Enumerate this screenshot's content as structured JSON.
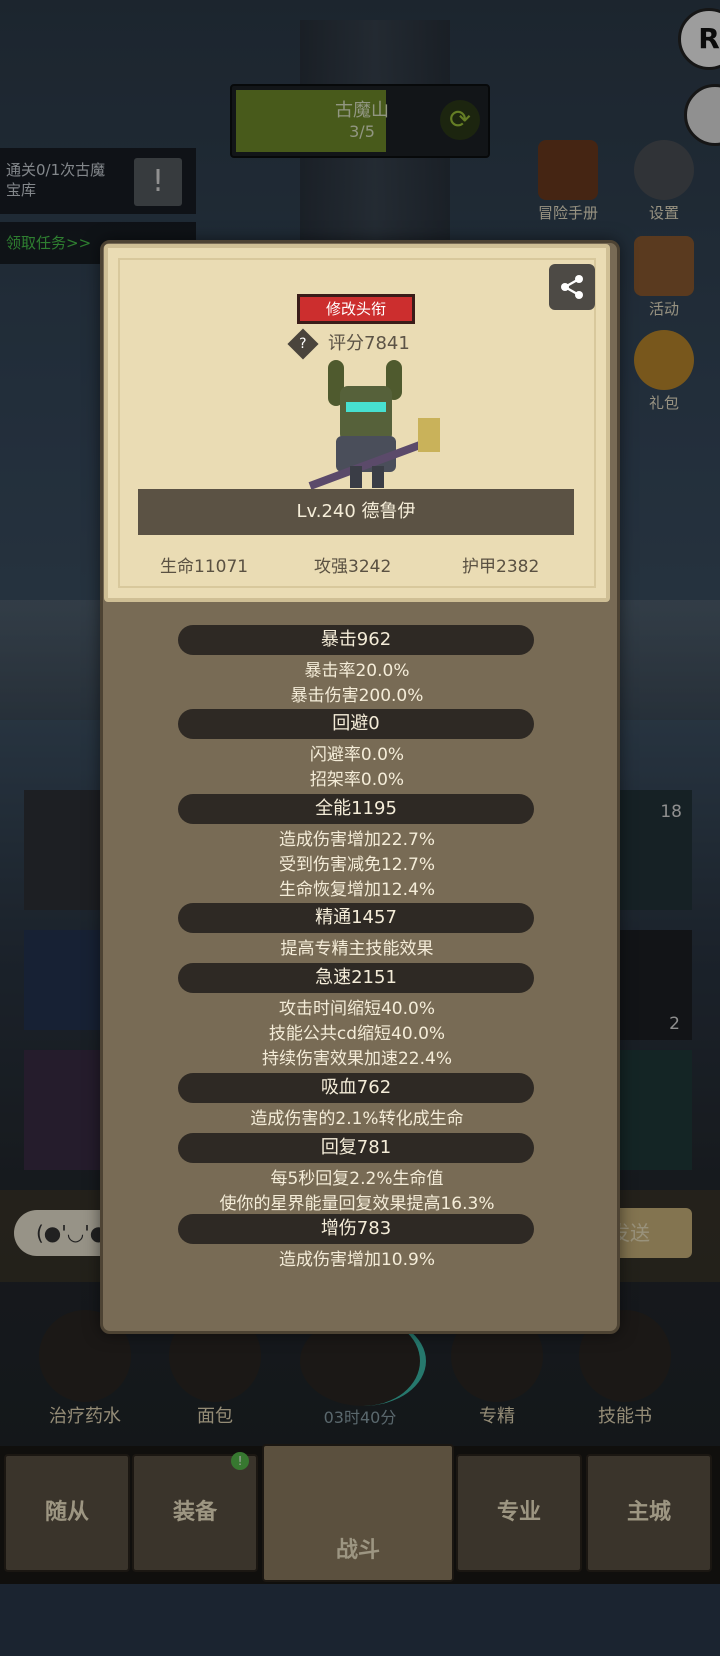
{
  "stage": {
    "name": "古魔山",
    "progress": "3/5"
  },
  "quest": {
    "text": "通关0/1次古魔宝库",
    "claim_label": "领取任务>>"
  },
  "right_menu": {
    "handbook": "冒险手册",
    "settings": "设置",
    "activity": "活动",
    "gift": "礼包"
  },
  "profile": {
    "edit_title_label": "修改头衔",
    "score": "评分7841",
    "name_level": "Lv.240 德鲁伊",
    "hp": "生命11071",
    "attack": "攻强3242",
    "armor": "护甲2382"
  },
  "stats": [
    {
      "header": "暴击962",
      "lines": [
        "暴击率20.0%",
        "暴击伤害200.0%"
      ]
    },
    {
      "header": "回避0",
      "lines": [
        "闪避率0.0%",
        "招架率0.0%"
      ]
    },
    {
      "header": "全能1195",
      "lines": [
        "造成伤害增加22.7%",
        "受到伤害减免12.7%",
        "生命恢复增加12.4%"
      ]
    },
    {
      "header": "精通1457",
      "lines": [
        "提高专精主技能效果"
      ]
    },
    {
      "header": "急速2151",
      "lines": [
        "攻击时间缩短40.0%",
        "技能公共cd缩短40.0%",
        "持续伤害效果加速22.4%"
      ]
    },
    {
      "header": "吸血762",
      "lines": [
        "造成伤害的2.1%转化成生命"
      ]
    },
    {
      "header": "回复781",
      "lines": [
        "每5秒回复2.2%生命值",
        "使你的星界能量回复效果提高16.3%"
      ]
    },
    {
      "header": "增伤783",
      "lines": [
        "造成伤害增加10.9%"
      ]
    }
  ],
  "background": {
    "badge_18": "18",
    "badge_2": "2",
    "chat_face": "(●'◡'●",
    "send": "发送",
    "timer": "03时40分"
  },
  "skills": {
    "potion": "治疗药水",
    "bread": "面包",
    "mastery": "专精",
    "skillbook": "技能书"
  },
  "tabs": {
    "follower": "随从",
    "equipment": "装备",
    "battle": "战斗",
    "profession": "专业",
    "city": "主城"
  },
  "colors": {
    "title_red": "#cc2e2e",
    "panel_bg": "#786b55",
    "card_bg": "#eadcb4"
  }
}
